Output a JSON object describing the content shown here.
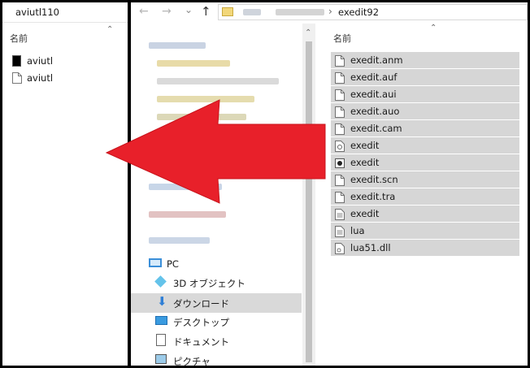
{
  "left_pane": {
    "address": "aviutl110",
    "header": "名前",
    "files": [
      {
        "name": "aviutl",
        "icon": "app-black-icon"
      },
      {
        "name": "aviutl",
        "icon": "document-icon"
      }
    ]
  },
  "mid_pane": {
    "toolbar": {
      "back": "←",
      "forward": "→",
      "dropdown": "⌄",
      "up": "↑",
      "sep": "›",
      "folder": "exedit92"
    },
    "nav_items": [
      {
        "label": "PC",
        "icon": "pc-icon"
      },
      {
        "label": "3D オブジェクト",
        "icon": "3d-object-icon"
      },
      {
        "label": "ダウンロード",
        "icon": "download-icon",
        "selected": true
      },
      {
        "label": "デスクトップ",
        "icon": "desktop-icon"
      },
      {
        "label": "ドキュメント",
        "icon": "documents-icon"
      },
      {
        "label": "ピクチャ",
        "icon": "pictures-icon"
      }
    ]
  },
  "right_pane": {
    "header": "名前",
    "files": [
      {
        "name": "exedit.anm",
        "icon": "document-icon"
      },
      {
        "name": "exedit.auf",
        "icon": "document-icon"
      },
      {
        "name": "exedit.aui",
        "icon": "document-icon"
      },
      {
        "name": "exedit.auo",
        "icon": "document-icon"
      },
      {
        "name": "exedit.cam",
        "icon": "document-icon"
      },
      {
        "name": "exedit",
        "icon": "settings-file-icon"
      },
      {
        "name": "exedit",
        "icon": "app-dark-icon"
      },
      {
        "name": "exedit.scn",
        "icon": "document-icon"
      },
      {
        "name": "exedit.tra",
        "icon": "document-icon"
      },
      {
        "name": "exedit",
        "icon": "text-file-icon"
      },
      {
        "name": "lua",
        "icon": "text-file-icon"
      },
      {
        "name": "lua51.dll",
        "icon": "dll-file-icon"
      }
    ]
  },
  "colors": {
    "arrow": "#e8202a",
    "selection": "#d6d6d6",
    "nav_selected": "#d9d9d9",
    "frame": "#000000"
  }
}
